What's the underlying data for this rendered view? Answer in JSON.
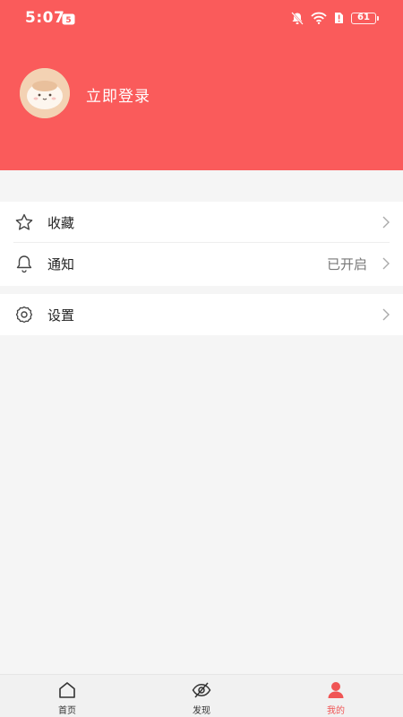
{
  "status_bar": {
    "time": "5:07",
    "battery": "61"
  },
  "profile": {
    "login_text": "立即登录"
  },
  "menu": {
    "items": [
      {
        "label": "收藏",
        "value": "",
        "icon": "star-icon"
      },
      {
        "label": "通知",
        "value": "已开启",
        "icon": "bell-icon"
      },
      {
        "label": "设置",
        "value": "",
        "icon": "gear-icon"
      }
    ]
  },
  "bottom_nav": {
    "items": [
      {
        "label": "首页",
        "icon": "home-icon",
        "active": false
      },
      {
        "label": "发现",
        "icon": "discover-icon",
        "active": false
      },
      {
        "label": "我的",
        "icon": "profile-icon",
        "active": true
      }
    ]
  },
  "colors": {
    "header": "#fa5b5b",
    "active_tab": "#f05555",
    "background": "#f5f5f5"
  }
}
